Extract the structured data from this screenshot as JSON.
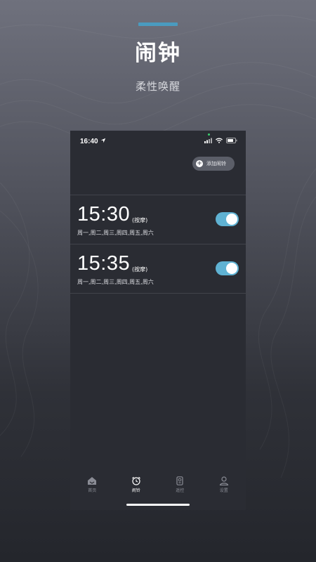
{
  "promo": {
    "title": "闹钟",
    "subtitle": "柔性唤醒"
  },
  "status_bar": {
    "time": "16:40"
  },
  "header": {
    "add_button_label": "添加闹铃"
  },
  "alarms": [
    {
      "time": "15:30",
      "label": "(按摩)",
      "days": "周一,周二,周三,周四,周五,周六",
      "enabled": true
    },
    {
      "time": "15:35",
      "label": "(按摩)",
      "days": "周一,周二,周三,周四,周五,周六",
      "enabled": true
    }
  ],
  "tab_bar": {
    "items": [
      {
        "label": "首页",
        "icon": "home-icon",
        "active": false
      },
      {
        "label": "闹铃",
        "icon": "alarm-clock-icon",
        "active": true
      },
      {
        "label": "遥控",
        "icon": "remote-icon",
        "active": false
      },
      {
        "label": "设置",
        "icon": "user-icon",
        "active": false
      }
    ]
  },
  "colors": {
    "accent": "#4a9bbf",
    "toggle_on": "#5fb2d3",
    "screen_bg": "#2a2c33"
  }
}
